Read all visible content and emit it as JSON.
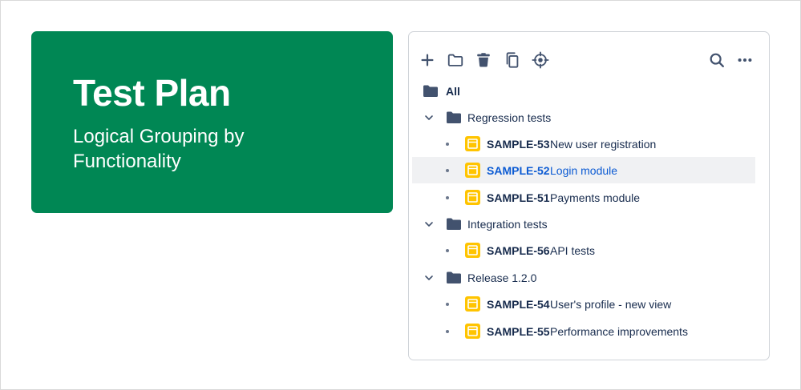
{
  "hero": {
    "title": "Test Plan",
    "subtitle": "Logical Grouping by Functionality",
    "background_color": "#008754"
  },
  "toolbar": {
    "left_actions": [
      "add-icon",
      "folder-icon",
      "trash-icon",
      "copy-icon",
      "crosshair-icon"
    ],
    "right_actions": [
      "search-icon",
      "more-icon"
    ]
  },
  "tree": {
    "root_label": "All",
    "folders": [
      {
        "label": "Regression tests",
        "expanded": true,
        "items": [
          {
            "key": "SAMPLE-53",
            "title": "New user registration",
            "selected": false
          },
          {
            "key": "SAMPLE-52",
            "title": "Login module",
            "selected": true
          },
          {
            "key": "SAMPLE-51",
            "title": "Payments module",
            "selected": false
          }
        ]
      },
      {
        "label": "Integration tests",
        "expanded": true,
        "items": [
          {
            "key": "SAMPLE-56",
            "title": "API tests",
            "selected": false
          }
        ]
      },
      {
        "label": "Release 1.2.0",
        "expanded": true,
        "items": [
          {
            "key": "SAMPLE-54",
            "title": "User's profile - new view",
            "selected": false
          },
          {
            "key": "SAMPLE-55",
            "title": "Performance improvements",
            "selected": false
          }
        ]
      }
    ]
  },
  "colors": {
    "text": "#172b4d",
    "selected_text": "#0c5bd3",
    "selected_row": "#f0f1f3",
    "test_icon": "#ffc400",
    "folder_icon": "#42526e"
  }
}
